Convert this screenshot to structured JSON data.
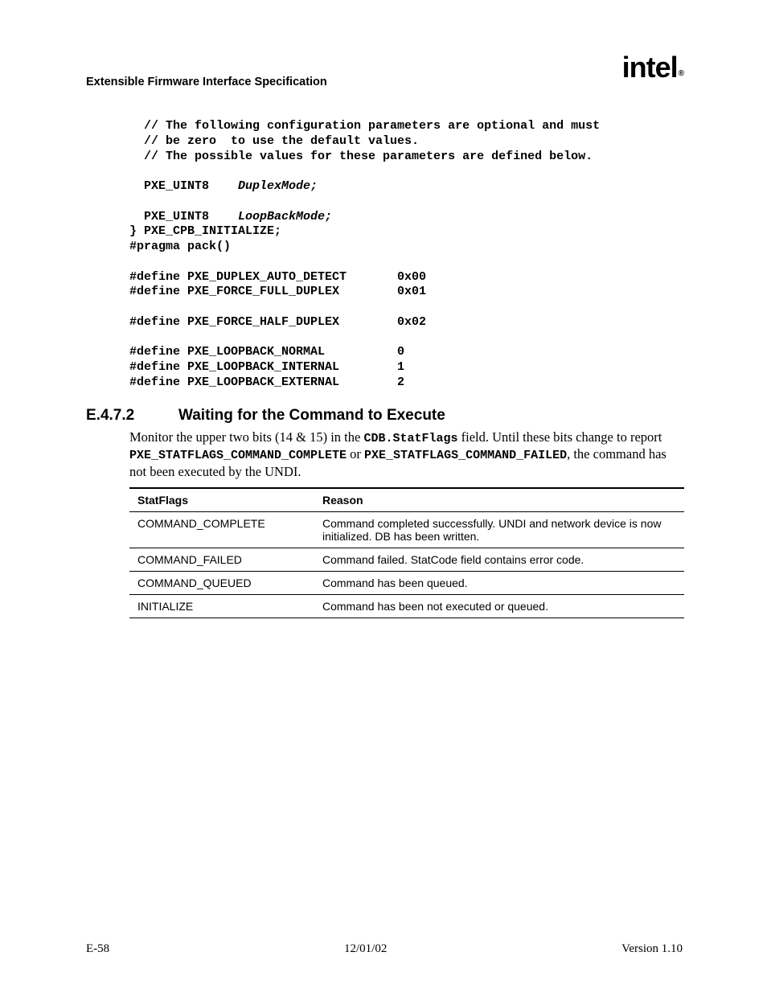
{
  "header": {
    "doc_title": "Extensible Firmware Interface Specification",
    "logo_text": "intel",
    "logo_reg": "®"
  },
  "code": {
    "c1": "  // The following configuration parameters are optional and must",
    "c2": "  // be zero  to use the default values.",
    "c3": "  // The possible values for these parameters are defined below.",
    "f1_type": "  PXE_UINT8    ",
    "f1_name": "DuplexMode;",
    "f2_type": "  PXE_UINT8    ",
    "f2_name": "LoopBackMode;",
    "struct_end": "} PXE_CPB_INITIALIZE;",
    "pragma": "#pragma pack()",
    "d1": "#define PXE_DUPLEX_AUTO_DETECT       0x00",
    "d2": "#define PXE_FORCE_FULL_DUPLEX        0x01",
    "d3": "#define PXE_FORCE_HALF_DUPLEX        0x02",
    "d4": "#define PXE_LOOPBACK_NORMAL          0",
    "d5": "#define PXE_LOOPBACK_INTERNAL        1",
    "d6": "#define PXE_LOOPBACK_EXTERNAL        2"
  },
  "section": {
    "number": "E.4.7.2",
    "title": "Waiting for the Command to Execute"
  },
  "para": {
    "p1a": "Monitor the upper two bits (14 & 15) in the ",
    "p1b": "CDB.StatFlags",
    "p1c": " field.  Until these bits change to report ",
    "p1d": "PXE_STATFLAGS_COMMAND_COMPLETE",
    "p1e": " or ",
    "p1f": "PXE_STATFLAGS_COMMAND_FAILED",
    "p1g": ", the command has not been executed by the UNDI."
  },
  "table": {
    "h1": "StatFlags",
    "h2": "Reason",
    "rows": [
      {
        "c1": "COMMAND_COMPLETE",
        "c2": "Command completed successfully.  UNDI and network device is now initialized.  DB has been written."
      },
      {
        "c1": "COMMAND_FAILED",
        "c2": "Command failed.  StatCode field contains error code."
      },
      {
        "c1": "COMMAND_QUEUED",
        "c2": "Command has been queued."
      },
      {
        "c1": "INITIALIZE",
        "c2": "Command has been not executed or queued."
      }
    ]
  },
  "footer": {
    "left": "E-58",
    "center": "12/01/02",
    "right": "Version 1.10"
  }
}
